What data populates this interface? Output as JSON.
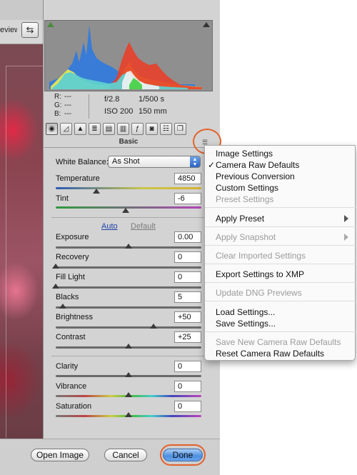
{
  "toolbar": {
    "preview_label": "eview",
    "toggle_icon": "toggle-view-icon"
  },
  "readout": {
    "r_label": "R:",
    "g_label": "G:",
    "b_label": "B:",
    "r_value": "---",
    "g_value": "---",
    "b_value": "---",
    "aperture": "f/2.8",
    "shutter": "1/500 s",
    "iso": "ISO 200",
    "focal": "150 mm"
  },
  "panel": {
    "title": "Basic"
  },
  "white_balance": {
    "label": "White Balance:",
    "value": "As Shot"
  },
  "controls": {
    "temperature": {
      "label": "Temperature",
      "value": "4850",
      "position": 0.28
    },
    "tint": {
      "label": "Tint",
      "value": "-6",
      "position": 0.48
    },
    "auto": "Auto",
    "default": "Default",
    "exposure": {
      "label": "Exposure",
      "value": "0.00",
      "position": 0.5
    },
    "recovery": {
      "label": "Recovery",
      "value": "0",
      "position": 0.0
    },
    "fill_light": {
      "label": "Fill Light",
      "value": "0",
      "position": 0.0
    },
    "blacks": {
      "label": "Blacks",
      "value": "5",
      "position": 0.05
    },
    "brightness": {
      "label": "Brightness",
      "value": "+50",
      "position": 0.67
    },
    "contrast": {
      "label": "Contrast",
      "value": "+25",
      "position": 0.5
    },
    "clarity": {
      "label": "Clarity",
      "value": "0",
      "position": 0.5
    },
    "vibrance": {
      "label": "Vibrance",
      "value": "0",
      "position": 0.5
    },
    "saturation": {
      "label": "Saturation",
      "value": "0",
      "position": 0.5
    }
  },
  "buttons": {
    "open": "Open Image",
    "cancel": "Cancel",
    "done": "Done"
  },
  "menu": {
    "image_settings": "Image Settings",
    "camera_raw_defaults": "Camera Raw Defaults",
    "previous_conversion": "Previous Conversion",
    "custom_settings": "Custom Settings",
    "preset_settings": "Preset Settings",
    "apply_preset": "Apply Preset",
    "apply_snapshot": "Apply Snapshot",
    "clear_imported": "Clear Imported Settings",
    "export_xmp": "Export Settings to XMP",
    "update_dng": "Update DNG Previews",
    "load_settings": "Load Settings...",
    "save_settings": "Save Settings...",
    "save_new_defaults": "Save New Camera Raw Defaults",
    "reset_defaults": "Reset Camera Raw Defaults",
    "checkmark": "✓"
  },
  "colors": {
    "highlight_circle": "#e2622b",
    "link": "#1d3fa8",
    "primary_button": "#4d8fe0"
  }
}
